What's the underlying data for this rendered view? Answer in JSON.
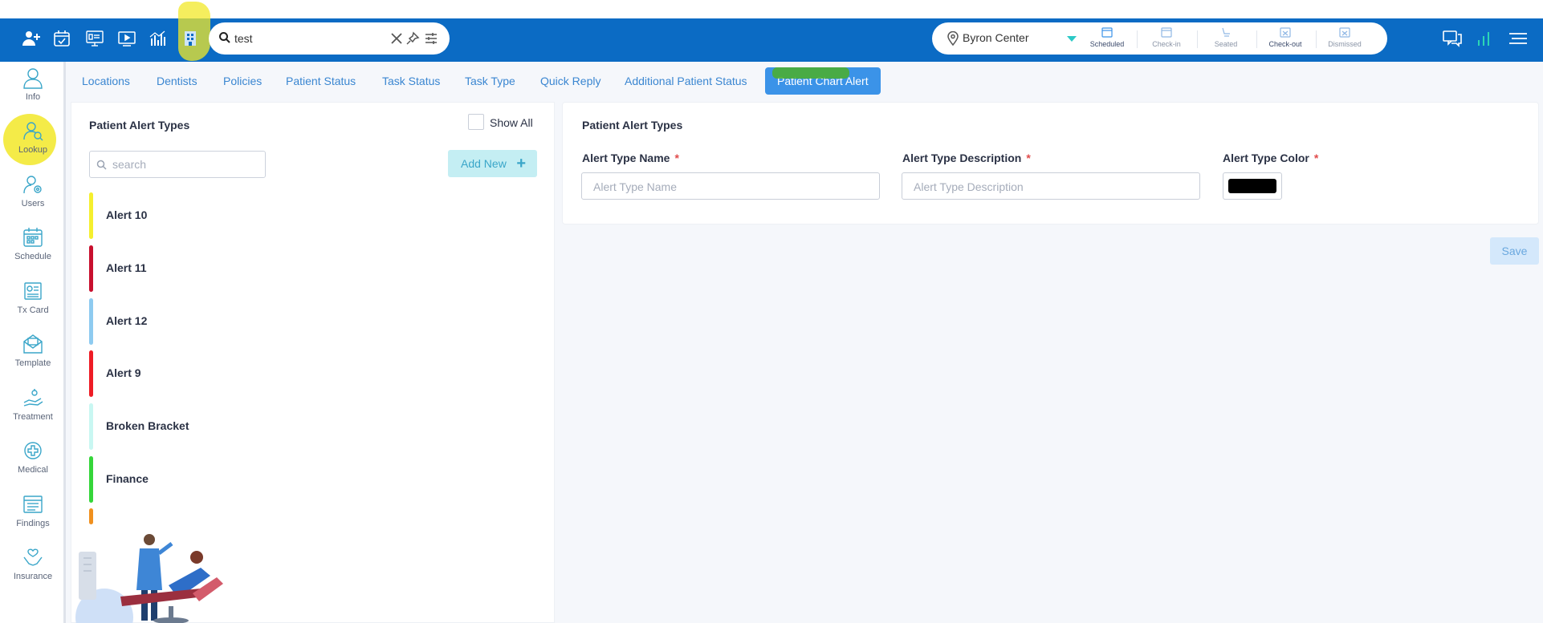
{
  "search": {
    "value": "test"
  },
  "location": {
    "name": "Byron Center",
    "statuses": [
      "Scheduled",
      "Check-in",
      "Seated",
      "Check-out",
      "Dismissed"
    ]
  },
  "sidebar": {
    "items": [
      {
        "label": "Info",
        "icon": "user-outline-icon"
      },
      {
        "label": "Lookup",
        "icon": "lookup-user-icon"
      },
      {
        "label": "Users",
        "icon": "users-settings-icon"
      },
      {
        "label": "Schedule",
        "icon": "calendar-icon"
      },
      {
        "label": "Tx Card",
        "icon": "tx-card-icon"
      },
      {
        "label": "Template",
        "icon": "template-envelope-icon"
      },
      {
        "label": "Treatment",
        "icon": "treatment-hand-icon"
      },
      {
        "label": "Medical",
        "icon": "medical-cross-icon"
      },
      {
        "label": "Findings",
        "icon": "findings-list-icon"
      },
      {
        "label": "Insurance",
        "icon": "insurance-hands-icon"
      }
    ]
  },
  "tabs": [
    "Locations",
    "Dentists",
    "Policies",
    "Patient Status",
    "Task Status",
    "Task Type",
    "Quick Reply",
    "Additional Patient Status",
    "Patient Chart Alert"
  ],
  "left_panel": {
    "title": "Patient Alert Types",
    "show_all": "Show All",
    "search_placeholder": "search",
    "add_new": "Add New",
    "alerts": [
      {
        "name": "Alert 10",
        "color": "#f5ef2e"
      },
      {
        "name": "Alert 11",
        "color": "#c8102e"
      },
      {
        "name": "Alert 12",
        "color": "#8ecbf0"
      },
      {
        "name": "Alert 9",
        "color": "#ee1c25"
      },
      {
        "name": "Broken Bracket",
        "color": "#c9f7f2"
      },
      {
        "name": "Finance",
        "color": "#35d63a"
      },
      {
        "name": "",
        "color": "#f0901e"
      }
    ]
  },
  "right_panel": {
    "title": "Patient Alert Types",
    "name_label": "Alert Type Name",
    "name_placeholder": "Alert Type Name",
    "desc_label": "Alert Type Description",
    "desc_placeholder": "Alert Type Description",
    "color_label": "Alert Type Color",
    "required_mark": "*",
    "color_value": "#000000",
    "save": "Save"
  }
}
